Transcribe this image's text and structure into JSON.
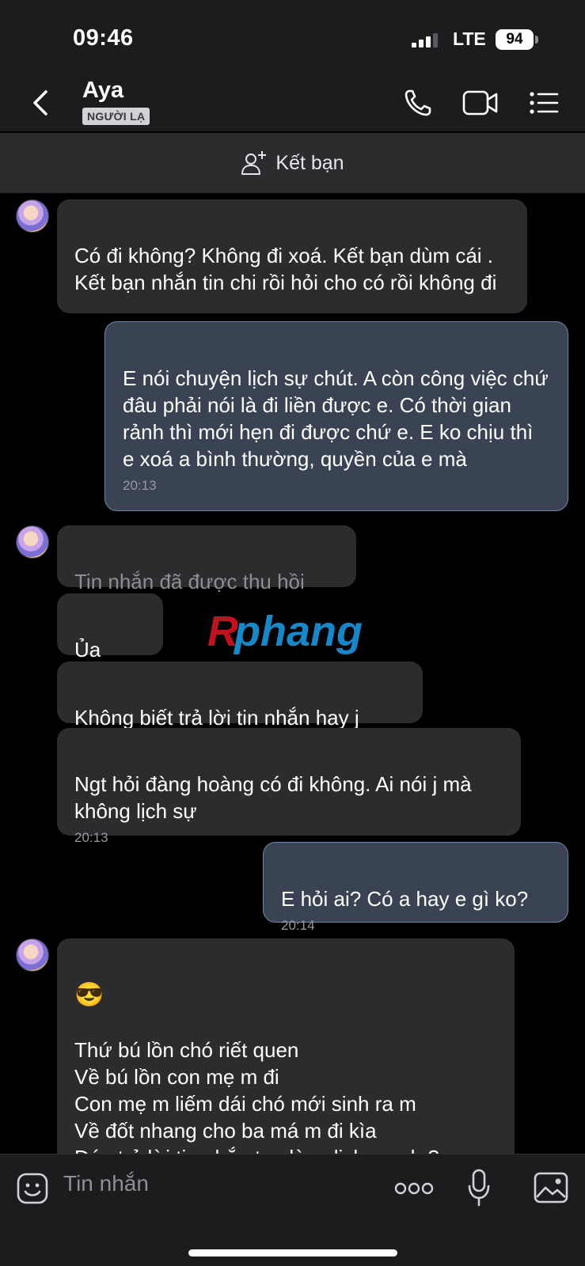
{
  "status_bar": {
    "time": "09:46",
    "network": "LTE",
    "battery": "94"
  },
  "header": {
    "contact_name": "Aya",
    "badge": "NGƯỜI LẠ"
  },
  "friend_bar": {
    "label": "Kết bạn"
  },
  "messages": [
    {
      "side": "in",
      "text": "Có đi không? Không đi xoá. Kết bạn dùm cái . Kết bạn nhắn tin chi rồi hỏi cho có rồi không đi"
    },
    {
      "side": "out",
      "text": "E nói chuyện lịch sự chút. A còn công việc chứ đâu phải nói là đi liền được e. Có thời gian rảnh thì mới hẹn đi được chứ e. E ko chịu thì e xoá a bình thường, quyền của e mà",
      "time": "20:13"
    },
    {
      "side": "in",
      "text": "Tin nhắn đã được thu hồi",
      "recalled": true
    },
    {
      "side": "in",
      "text": "Ủa"
    },
    {
      "side": "in",
      "text": "Không biết trả lời tin nhắn hay j"
    },
    {
      "side": "in",
      "text": "Ngt hỏi đàng hoàng có đi không. Ai nói j mà không lịch sự",
      "time": "20:13"
    },
    {
      "side": "out",
      "text": "E hỏi ai? Có a hay e gì ko?",
      "time": "20:14"
    },
    {
      "side": "in",
      "emoji": "😎",
      "text": "Thứ bú lồn chó riết quen\nVề bú lồn con mẹ m đi\nCon mẹ m liếm dái chó mới sinh ra m\nVề đốt nhang cho ba má m đi kìa\nĐéo trả lời tin nhắn tao là m lịch sự ch ?\nĐĩ mẹ m"
    }
  ],
  "watermark": "Rphang",
  "input_bar": {
    "placeholder": "Tin nhắn"
  },
  "colors": {
    "incoming_bubble": "#2c2c2e",
    "outgoing_bubble": "#3a4353",
    "outgoing_border": "#6f86a8",
    "header_bg": "#1c1c1e"
  },
  "icons": [
    "back-icon",
    "phone-icon",
    "video-call-icon",
    "menu-list-icon",
    "add-friend-icon",
    "sticker-icon",
    "more-dots-icon",
    "microphone-icon",
    "gallery-icon"
  ]
}
